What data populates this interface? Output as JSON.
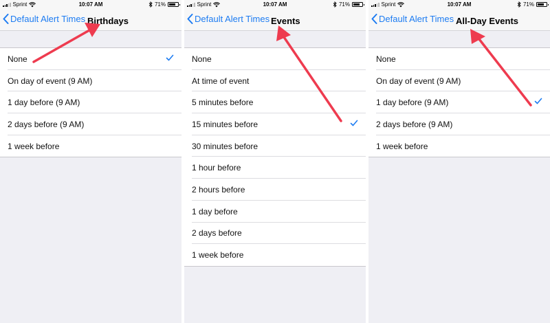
{
  "status_bar": {
    "carrier": "Sprint",
    "time": "10:07 AM",
    "battery": "71%",
    "battery_level": 0.71
  },
  "panels": [
    {
      "back_label": "Default Alert Times",
      "title": "Birthdays",
      "options": [
        "None",
        "On day of event (9 AM)",
        "1 day before (9 AM)",
        "2 days before (9 AM)",
        "1 week before"
      ],
      "selected_index": 0
    },
    {
      "back_label": "Default Alert Times",
      "title": "Events",
      "options": [
        "None",
        "At time of event",
        "5 minutes before",
        "15 minutes before",
        "30 minutes before",
        "1 hour before",
        "2 hours before",
        "1 day before",
        "2 days before",
        "1 week before"
      ],
      "selected_index": 3
    },
    {
      "back_label": "Default Alert Times",
      "title": "All-Day Events",
      "options": [
        "None",
        "On day of event (9 AM)",
        "1 day before (9 AM)",
        "2 days before (9 AM)",
        "1 week before"
      ],
      "selected_index": 2
    }
  ],
  "colors": {
    "accent": "#1d7cf2",
    "annotation_arrow": "#ee3b4f"
  },
  "icons": [
    "signal-icon",
    "wifi-icon",
    "bluetooth-icon",
    "battery-icon",
    "back-chevron-icon",
    "checkmark-icon",
    "annotation-arrow-icon"
  ]
}
